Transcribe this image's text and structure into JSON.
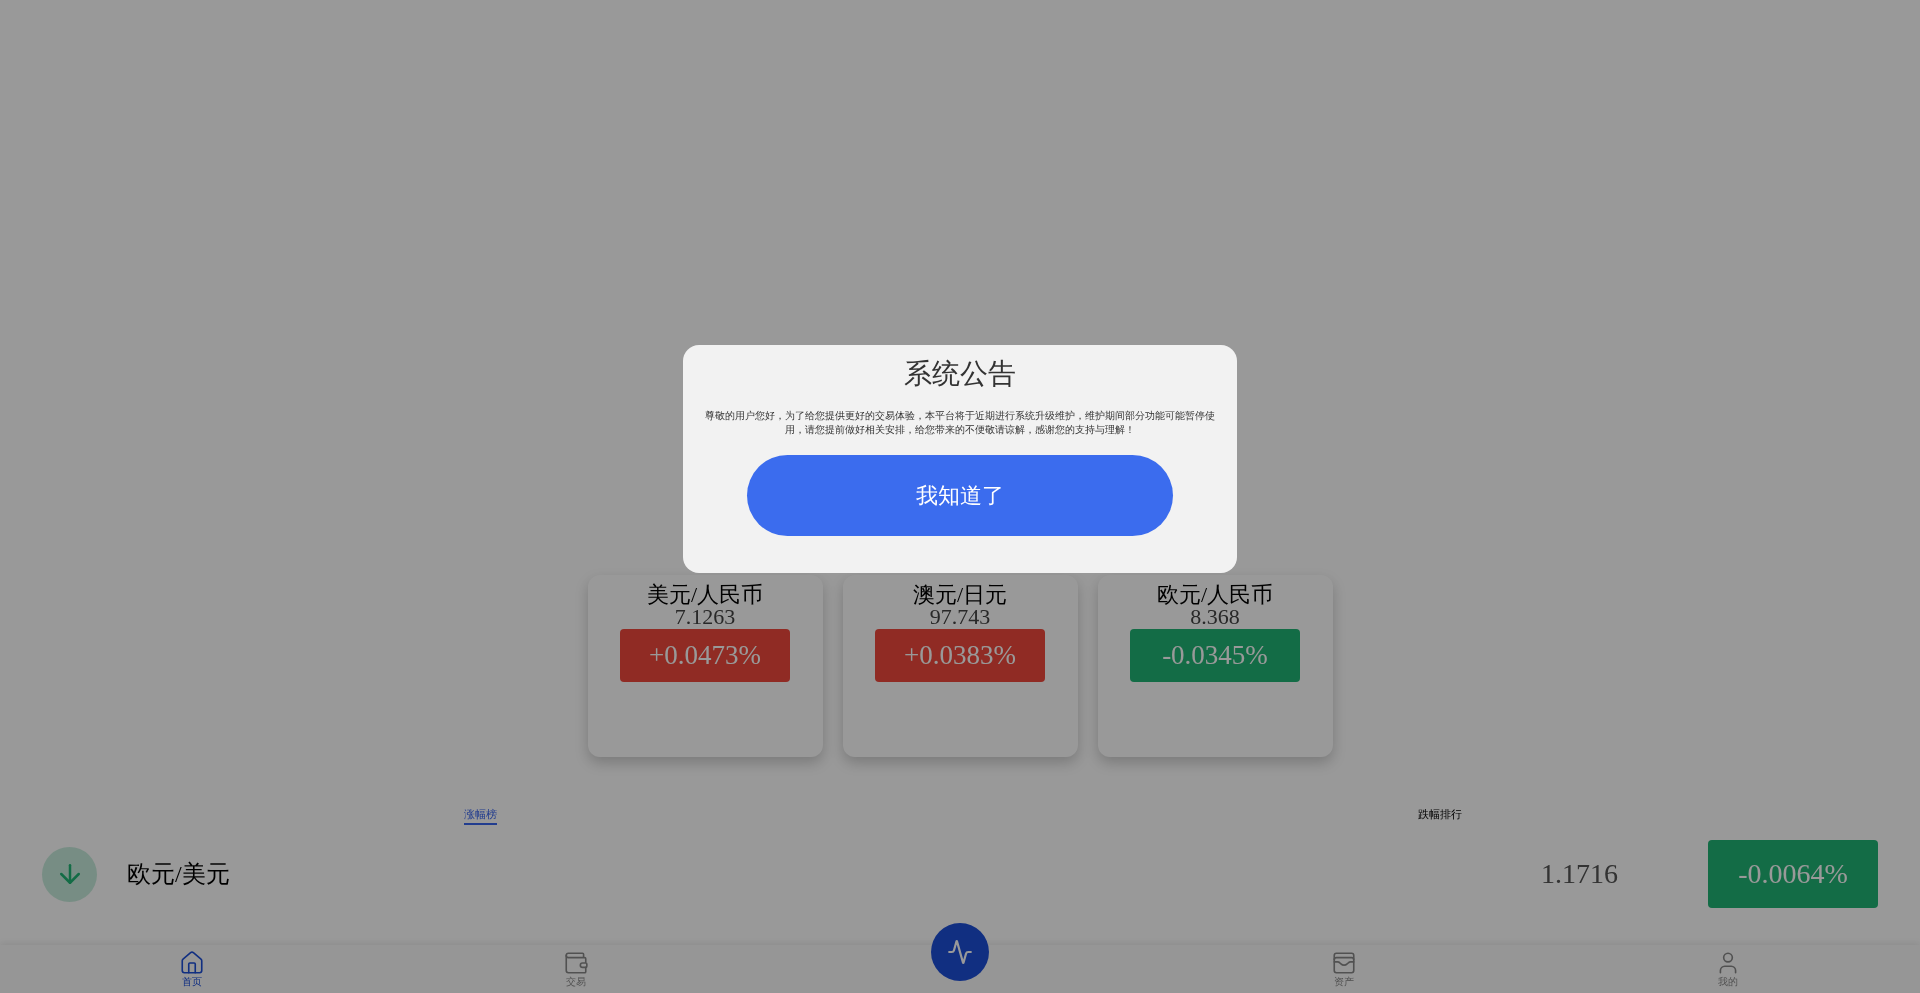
{
  "quotes": [
    {
      "pair": "美元/人民币",
      "price": "7.1263",
      "change": "+0.0473%",
      "color": "#902c24"
    },
    {
      "pair": "澳元/日元",
      "price": "97.743",
      "change": "+0.0383%",
      "color": "#902c24"
    },
    {
      "pair": "欧元/人民币",
      "price": "8.368",
      "change": "-0.0345%",
      "color": "#146c46"
    }
  ],
  "tabs": [
    {
      "label": "涨幅榜",
      "selected": true
    },
    {
      "label": "跌幅排行",
      "selected": false
    }
  ],
  "rows": [
    {
      "pair": "欧元/美元",
      "price": "1.1716",
      "change": "-0.0064%",
      "color": "#146c46"
    }
  ],
  "nav": [
    {
      "kind": "home",
      "label": "首页",
      "selected": true
    },
    {
      "kind": "wallet",
      "label": "交易",
      "selected": false
    },
    {
      "kind": "center"
    },
    {
      "kind": "coins",
      "label": "资产",
      "selected": false
    },
    {
      "kind": "user",
      "label": "我的",
      "selected": false
    }
  ],
  "dialog": {
    "title": "系统公告",
    "body": "尊敬的用户您好，为了给您提供更好的交易体验，本平台将于近期进行系统升级维护，维护期间部分功能可能暂停使用，请您提前做好相关安排，给您带来的不便敬请谅解，感谢您的支持与理解！",
    "button": "我知道了"
  }
}
